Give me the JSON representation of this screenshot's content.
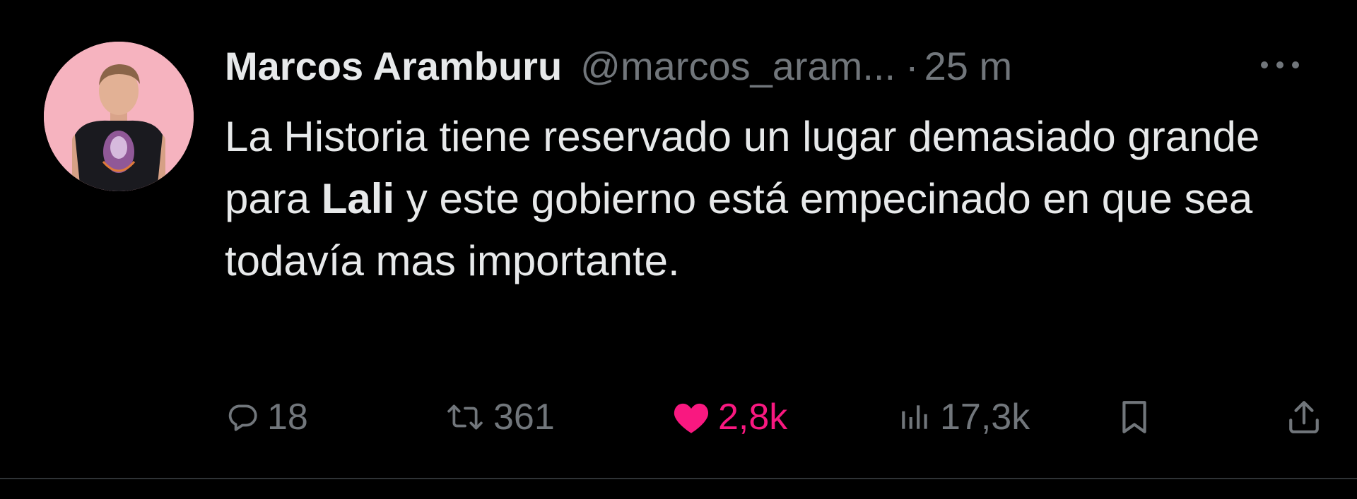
{
  "tweet": {
    "author": {
      "display_name": "Marcos Aramburu",
      "handle": "@marcos_aram...",
      "avatar": "profile-photo"
    },
    "separator": "·",
    "time": "25 m",
    "more_icon": "more-horizontal-icon",
    "text": {
      "part1": "La Historia tiene reservado un lugar demasiado grande para ",
      "bold": "Lali",
      "part2": " y este gobierno está empecinado en que sea todavía mas importante."
    },
    "actions": {
      "reply": {
        "icon": "reply-icon",
        "count": "18"
      },
      "retweet": {
        "icon": "retweet-icon",
        "count": "361"
      },
      "like": {
        "icon": "heart-icon",
        "count": "2,8k",
        "active": true
      },
      "views": {
        "icon": "views-icon",
        "count": "17,3k"
      },
      "bookmark": {
        "icon": "bookmark-icon"
      },
      "share": {
        "icon": "share-icon"
      }
    }
  },
  "colors": {
    "background": "#000000",
    "text_primary": "#e7e9ea",
    "text_secondary": "#71767b",
    "like_active": "#f91880",
    "avatar_background": "#f6b3bf",
    "divider": "#2f3336"
  }
}
